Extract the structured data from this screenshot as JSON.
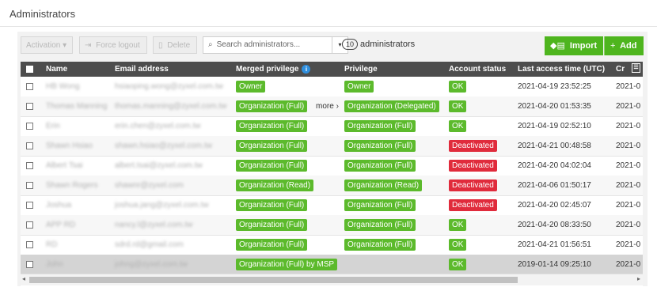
{
  "page": {
    "title": "Administrators"
  },
  "toolbar": {
    "activation_label": "Activation",
    "activation_caret": "▾",
    "force_logout_label": "Force logout",
    "delete_label": "Delete",
    "search_placeholder": "Search administrators...",
    "search_dropdown": "▾",
    "count_value": "10",
    "count_label": "administrators",
    "import_label": "Import",
    "add_label": "Add",
    "add_plus": "+"
  },
  "table": {
    "columns": {
      "name": "Name",
      "email": "Email address",
      "merged": "Merged privilege",
      "privilege": "Privilege",
      "status": "Account status",
      "last_access": "Last access time (UTC)",
      "created": "Cr"
    },
    "more_label": "more",
    "more_chevron": "›",
    "rows": [
      {
        "name": "HB Wong",
        "email": "hsiaoping.wong@zyxel.com.tw",
        "merged": "Owner",
        "privilege": "Owner",
        "status": "OK",
        "last_access": "2021-04-19 23:52:25",
        "created": "2021-0"
      },
      {
        "name": "Thomas Manning",
        "email": "thomas.manning@zyxel.com.tw",
        "merged": "Organization (Full)",
        "privilege": "Organization (Delegated)",
        "status": "OK",
        "last_access": "2021-04-20 01:53:35",
        "created": "2021-0"
      },
      {
        "name": "Erin",
        "email": "erin.chen@zyxel.com.tw",
        "merged": "Organization (Full)",
        "privilege": "Organization (Full)",
        "status": "OK",
        "last_access": "2021-04-19 02:52:10",
        "created": "2021-0"
      },
      {
        "name": "Shawn Hsiao",
        "email": "shawn.hsiao@zyxel.com.tw",
        "merged": "Organization (Full)",
        "privilege": "Organization (Full)",
        "status": "Deactivated",
        "last_access": "2021-04-21 00:48:58",
        "created": "2021-0"
      },
      {
        "name": "Albert Tsai",
        "email": "albert.tsai@zyxel.com.tw",
        "merged": "Organization (Full)",
        "privilege": "Organization (Full)",
        "status": "Deactivated",
        "last_access": "2021-04-20 04:02:04",
        "created": "2021-0"
      },
      {
        "name": "Shawn Rogers",
        "email": "shawnr@zyxel.com",
        "merged": "Organization (Read)",
        "privilege": "Organization (Read)",
        "status": "Deactivated",
        "last_access": "2021-04-06 01:50:17",
        "created": "2021-0"
      },
      {
        "name": "Joshua",
        "email": "joshua.jang@zyxel.com.tw",
        "merged": "Organization (Full)",
        "privilege": "Organization (Full)",
        "status": "Deactivated",
        "last_access": "2021-04-20 02:45:07",
        "created": "2021-0"
      },
      {
        "name": "APP RD",
        "email": "nancy.l@zyxel.com.tw",
        "merged": "Organization (Full)",
        "privilege": "Organization (Full)",
        "status": "OK",
        "last_access": "2021-04-20 08:33:50",
        "created": "2021-0"
      },
      {
        "name": "RD",
        "email": "sdrd.rd@gmail.com",
        "merged": "Organization (Full)",
        "privilege": "Organization (Full)",
        "status": "OK",
        "last_access": "2021-04-21 01:56:51",
        "created": "2021-0"
      },
      {
        "name": "John",
        "email": "johng@zyxel.com.tw",
        "merged": "Organization (Full) by MSP",
        "privilege": "",
        "status": "OK",
        "last_access": "2019-01-14 09:25:10",
        "created": "2021-0"
      }
    ]
  },
  "colors": {
    "green": "#4eb51e",
    "badge_green": "#5cba2c",
    "badge_red": "#e02b3c",
    "header": "#4d4d4d"
  },
  "icons": {
    "search": "search-icon",
    "import": "import-icon",
    "add": "plus-icon",
    "info": "info-icon",
    "columns": "columns-icon"
  }
}
